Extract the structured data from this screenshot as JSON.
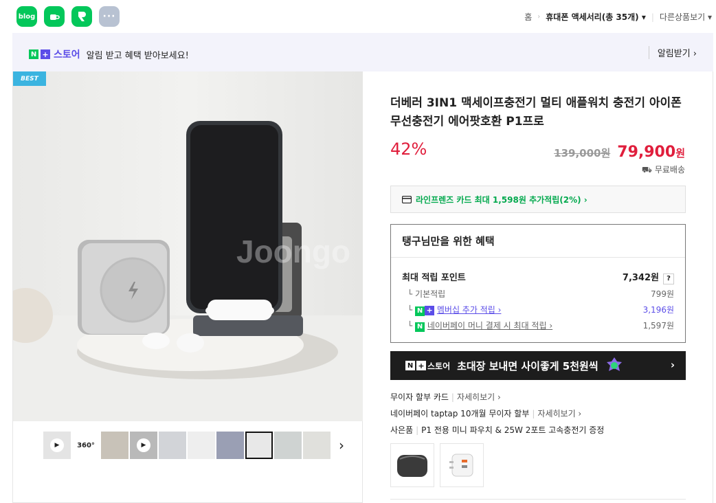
{
  "sns": [
    {
      "label": "blog",
      "icon": "blog-icon"
    },
    {
      "label": "cafe",
      "icon": "cafe-icon"
    },
    {
      "label": "band",
      "icon": "band-icon"
    },
    {
      "label": "···",
      "icon": "more-icon"
    }
  ],
  "breadcrumb": {
    "home": "홈",
    "category": "휴대폰 액세서리(총 35개)",
    "other": "다른상품보기"
  },
  "alarm": {
    "n": "N",
    "plus": "+",
    "store": "스토어",
    "message": "알림 받고 혜택 받아보세요!",
    "button": "알림받기 ›"
  },
  "product": {
    "badge": "BEST",
    "title": "더베러 3IN1 맥세이프충전기 멀티 애플워치 충전기 아이폰 무선충전기 에어팟호환 P1프로",
    "discount": "42%",
    "original_price": "139,000원",
    "price": "79,900",
    "price_unit": "원",
    "shipping": "무료배송",
    "card_benefit": "라인프렌즈 카드 최대 1,598원 추가적립(2%) ›"
  },
  "benefit": {
    "heading": "탱구님만을 위한 혜택",
    "max_point_label": "최대 적립 포인트",
    "max_point_value": "7,342원",
    "help": "?",
    "rows": [
      {
        "label": "기본적립",
        "value": "799원"
      },
      {
        "label": "멤버십 추가 적립 ›",
        "value": "3,196원"
      },
      {
        "label": "네이버페이 머니 결제 시 최대 적립 ›",
        "value": "1,597원"
      }
    ]
  },
  "banner": {
    "brand": "스토어",
    "text": "초대장 보내면 사이좋게 5천원씩",
    "arrow": "›"
  },
  "payment": {
    "line1": "무이자 할부 카드",
    "line1_detail": "자세히보기 ›",
    "line2": "네이버페이 taptap 10개월 무이자 할부",
    "line2_detail": "자세히보기 ›",
    "gift_label": "사은품",
    "gift_text": "P1 전용 미니 파우치 & 25W 2포트 고속충전기 증정"
  },
  "thumbnails": [
    "video",
    "360",
    "image",
    "video",
    "image",
    "image",
    "image",
    "image-selected",
    "image",
    "image"
  ],
  "thumb_360": "360°",
  "watermark": "Joongo"
}
